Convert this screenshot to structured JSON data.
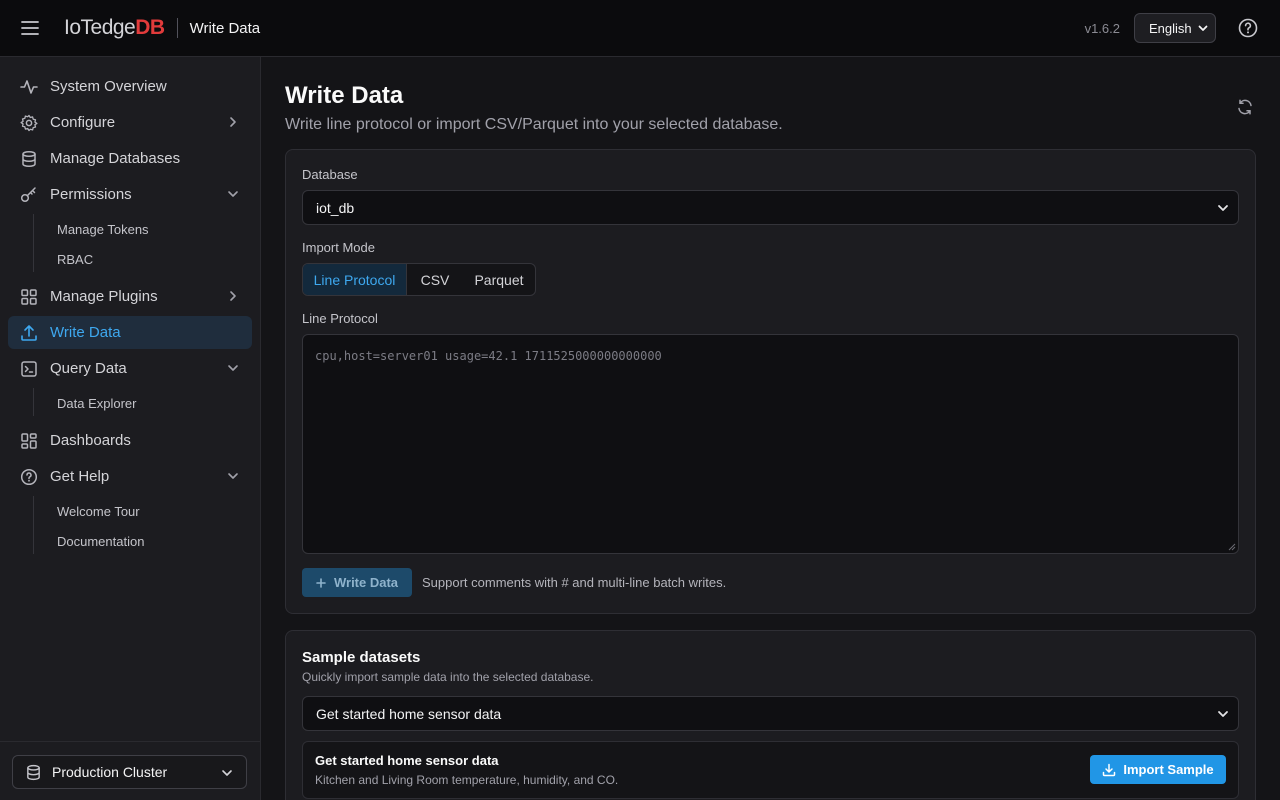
{
  "app": {
    "logo_main": "IoTedge",
    "logo_accent": "DB",
    "page_title": "Write Data",
    "version": "v1.6.2",
    "language": "English"
  },
  "sidebar": {
    "items": [
      {
        "label": "System Overview",
        "icon": "activity-icon"
      },
      {
        "label": "Configure",
        "icon": "gear-icon"
      },
      {
        "label": "Manage Databases",
        "icon": "database-icon"
      },
      {
        "label": "Permissions",
        "icon": "key-icon"
      },
      {
        "label": "Manage Plugins",
        "icon": "grid-icon"
      },
      {
        "label": "Write Data",
        "icon": "upload-icon",
        "active": true
      },
      {
        "label": "Query Data",
        "icon": "terminal-icon"
      },
      {
        "label": "Dashboards",
        "icon": "dashboard-icon"
      },
      {
        "label": "Get Help",
        "icon": "help-circle-icon"
      }
    ],
    "permissions_sub": [
      "Manage Tokens",
      "RBAC"
    ],
    "query_sub": [
      "Data Explorer"
    ],
    "help_sub": [
      "Welcome Tour",
      "Documentation"
    ],
    "cluster": "Production Cluster"
  },
  "main": {
    "title": "Write Data",
    "subtitle": "Write line protocol or import CSV/Parquet into your selected database.",
    "database_label": "Database",
    "database_value": "iot_db",
    "import_mode_label": "Import Mode",
    "modes": [
      "Line Protocol",
      "CSV",
      "Parquet"
    ],
    "line_protocol_label": "Line Protocol",
    "line_protocol_placeholder": "cpu,host=server01 usage=42.1 1711525000000000000",
    "write_button": "Write Data",
    "write_hint": "Support comments with # and multi-line batch writes."
  },
  "samples": {
    "title": "Sample datasets",
    "subtitle": "Quickly import sample data into the selected database.",
    "selected": "Get started home sensor data",
    "card_name": "Get started home sensor data",
    "card_desc": "Kitchen and Living Room temperature, humidity, and CO.",
    "import_button": "Import Sample"
  },
  "colors": {
    "accent": "#3ea8ef",
    "logo_accent": "#e23b3b",
    "primary_button": "#2196e6"
  }
}
